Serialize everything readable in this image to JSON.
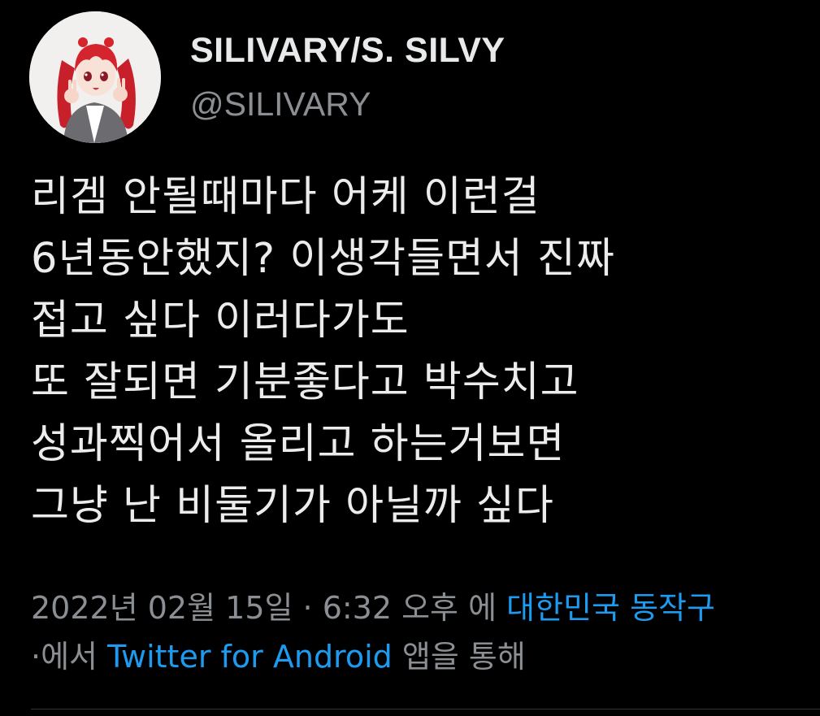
{
  "user": {
    "display_name": "SILIVARY/S. SILVY",
    "handle": "@SILIVARY",
    "avatar_icon": "anime-girl-avatar"
  },
  "tweet": {
    "lines": [
      "리겜 안될때마다 어케 이런걸",
      "6년동안했지? 이생각들면서 진짜",
      "접고 싶다 이러다가도",
      "또 잘되면 기분좋다고 박수치고",
      "성과찍어서 올리고 하는거보면",
      "그냥 난 비둘기가 아닐까 싶다"
    ]
  },
  "meta": {
    "date": "2022년 02월 15일 · 6:32 오후 에",
    "location": "대한민국 동작구",
    "via_prefix": "·에서",
    "source_app": "Twitter for Android",
    "via_suffix": "앱을 통해"
  },
  "colors": {
    "background": "#000000",
    "text": "#e7e9ea",
    "muted": "#8b8f94",
    "link": "#1d9bf0"
  }
}
